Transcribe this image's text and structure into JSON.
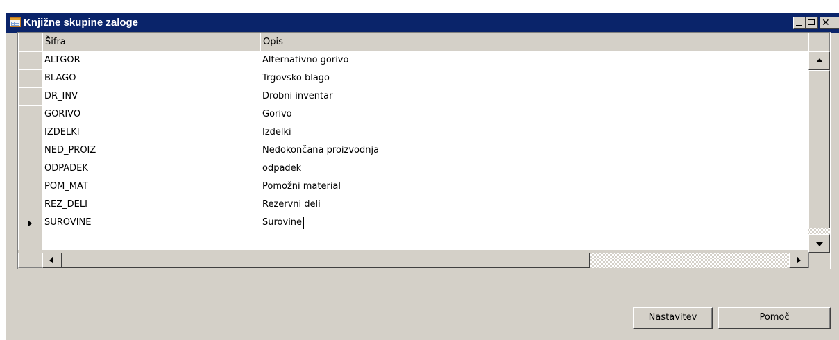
{
  "window": {
    "title": "Knjižne skupine zaloge",
    "close_glyph": "✕"
  },
  "table": {
    "columns": [
      "Šifra",
      "Opis"
    ],
    "rows": [
      {
        "code": "ALTGOR",
        "description": "Alternativno gorivo"
      },
      {
        "code": "BLAGO",
        "description": "Trgovsko blago"
      },
      {
        "code": "DR_INV",
        "description": "Drobni inventar"
      },
      {
        "code": "GORIVO",
        "description": "Gorivo"
      },
      {
        "code": "IZDELKI",
        "description": "Izdelki"
      },
      {
        "code": "NED_PROIZ",
        "description": "Nedokončana proizvodnja"
      },
      {
        "code": "ODPADEK",
        "description": "odpadek"
      },
      {
        "code": "POM_MAT",
        "description": "Pomožni material"
      },
      {
        "code": "REZ_DELI",
        "description": "Rezervni deli"
      },
      {
        "code": "SUROVINE",
        "description": "Surovine"
      },
      {
        "code": "",
        "description": ""
      }
    ],
    "selected_row": 9
  },
  "buttons": {
    "setup_pre": "Na",
    "setup_mnemonic": "s",
    "setup_post": "tavitev",
    "help": "Pomoč"
  },
  "colors": {
    "titlebar": "#0a246a",
    "face": "#d4d0c8"
  }
}
